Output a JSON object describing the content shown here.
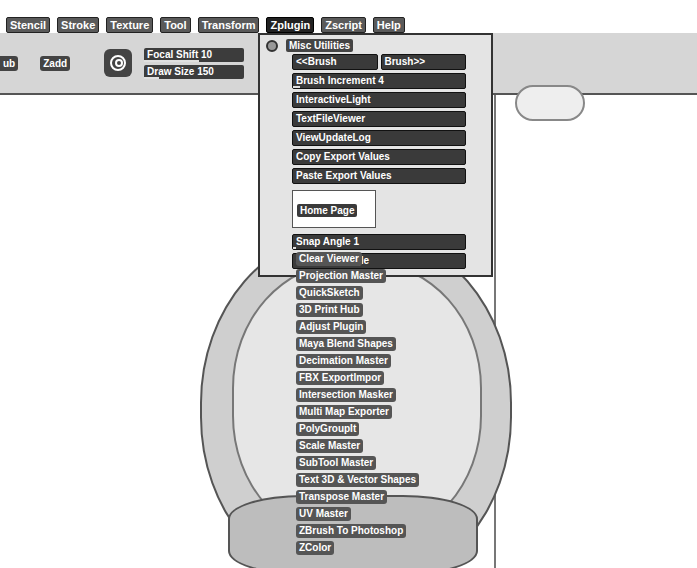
{
  "menu_bar": [
    {
      "label": "Stencil",
      "selected": false
    },
    {
      "label": "Stroke",
      "selected": false
    },
    {
      "label": "Texture",
      "selected": false
    },
    {
      "label": "Tool",
      "selected": false
    },
    {
      "label": "Transform",
      "selected": false
    },
    {
      "label": "Zplugin",
      "selected": true
    },
    {
      "label": "Zscript",
      "selected": false
    },
    {
      "label": "Help",
      "selected": false
    }
  ],
  "toolbar": {
    "cut_button": "ub",
    "mode_button": "Zadd",
    "sliders": [
      {
        "label": "Focal Shift 10",
        "level": 0.55
      },
      {
        "label": "Draw Size 150",
        "level": 0.15
      }
    ]
  },
  "zplugin_menu": {
    "title": "Misc Utilities",
    "items": [
      {
        "kind": "pair",
        "labels": [
          "<<Brush",
          "Brush>>"
        ]
      },
      {
        "kind": "slider",
        "label": "Brush Increment 4",
        "level": 0.04
      },
      {
        "kind": "button",
        "label": "InteractiveLight"
      },
      {
        "kind": "button",
        "label": "TextFileViewer"
      },
      {
        "kind": "button",
        "label": "ViewUpdateLog"
      },
      {
        "kind": "button",
        "label": "Copy Export Values"
      },
      {
        "kind": "button",
        "label": "Paste Export Values"
      },
      {
        "kind": "link",
        "label": "Home Page"
      },
      {
        "kind": "slider",
        "label": "Snap Angle 1",
        "level": 0.02
      },
      {
        "kind": "button",
        "label": "Set Snap Angle"
      }
    ]
  },
  "plugin_list": [
    "Clear Viewer",
    "Projection Master",
    "QuickSketch",
    "3D Print Hub",
    "Adjust Plugin",
    "Maya Blend Shapes",
    "Decimation Master",
    "FBX ExportImpor",
    "Intersection Masker",
    "Multi Map Exporter",
    "PolyGroupIt",
    "Scale Master",
    "SubTool Master",
    "Text 3D & Vector Shapes",
    "Transpose Master",
    "UV Master",
    "ZBrush To Photoshop",
    "ZColor"
  ]
}
